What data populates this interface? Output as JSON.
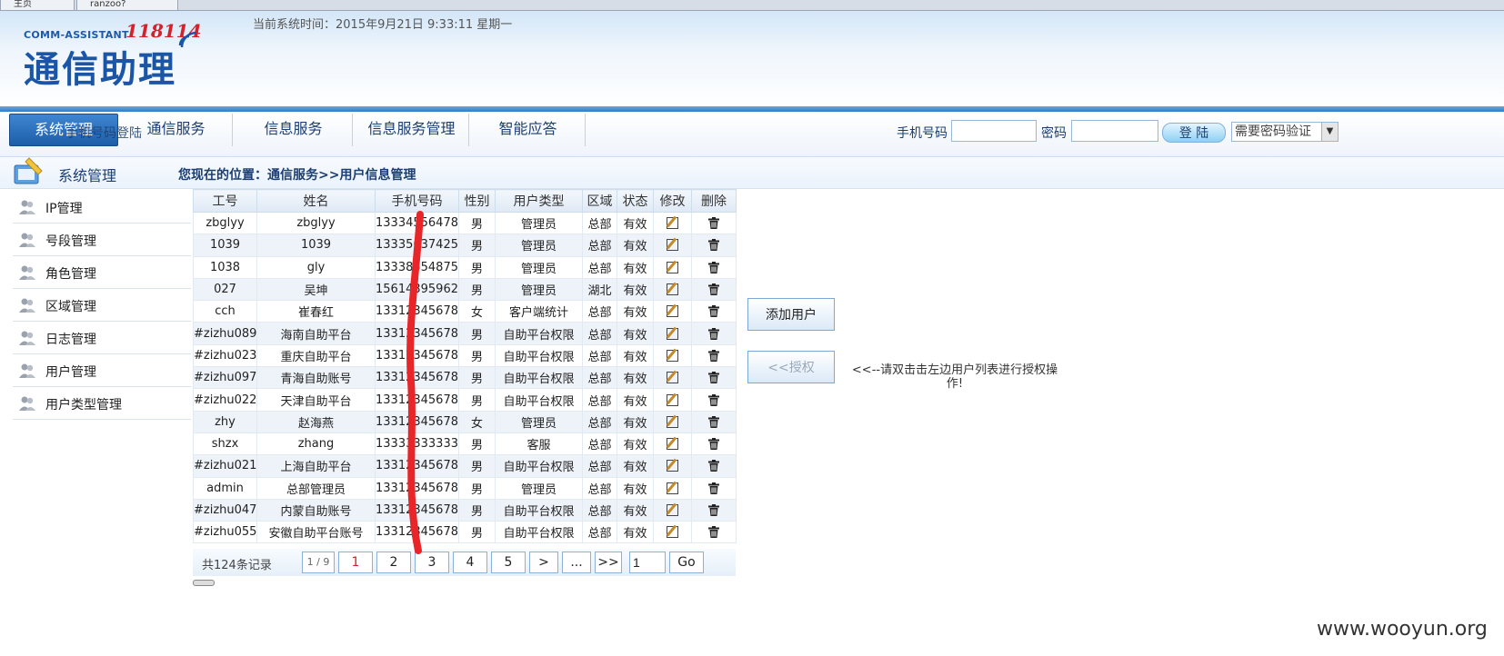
{
  "browser_tabs": [
    "主页",
    "ranzoo?"
  ],
  "header": {
    "logo_small": "COMM-ASSISTANT",
    "logo_number": "118114",
    "logo_big": "通信助理",
    "system_time": "当前系统时间：2015年9月21日 9:33:11 星期一"
  },
  "nav": {
    "tabs": [
      "系统管理",
      "通信服务",
      "信息服务",
      "信息服务管理",
      "智能应答"
    ],
    "ghost_text": "手机号码登陆"
  },
  "login": {
    "phone_label": "手机号码",
    "password_label": "密码",
    "login_button": "登 陆",
    "select_value": "需要密码验证"
  },
  "section": {
    "title": "系统管理",
    "breadcrumb": "您现在的位置：通信服务>>用户信息管理"
  },
  "sidebar": {
    "items": [
      "IP管理",
      "号段管理",
      "角色管理",
      "区域管理",
      "日志管理",
      "用户管理",
      "用户类型管理"
    ]
  },
  "table": {
    "headers": [
      "工号",
      "姓名",
      "手机号码",
      "性别",
      "用户类型",
      "区域",
      "状态",
      "修改",
      "删除"
    ],
    "rows": [
      [
        "zbglyy",
        "zbglyy",
        "13334556478",
        "男",
        "管理员",
        "总部",
        "有效"
      ],
      [
        "1039",
        "1039",
        "13335637425",
        "男",
        "管理员",
        "总部",
        "有效"
      ],
      [
        "1038",
        "gly",
        "13338554875",
        "男",
        "管理员",
        "总部",
        "有效"
      ],
      [
        "027",
        "吴坤",
        "15614395962",
        "男",
        "管理员",
        "湖北",
        "有效"
      ],
      [
        "cch",
        "崔春红",
        "13312345678",
        "女",
        "客户端统计",
        "总部",
        "有效"
      ],
      [
        "#zizhu089",
        "海南自助平台",
        "13312345678",
        "男",
        "自助平台权限",
        "总部",
        "有效"
      ],
      [
        "#zizhu023",
        "重庆自助平台",
        "13312345678",
        "男",
        "自助平台权限",
        "总部",
        "有效"
      ],
      [
        "#zizhu097",
        "青海自助账号",
        "13312345678",
        "男",
        "自助平台权限",
        "总部",
        "有效"
      ],
      [
        "#zizhu022",
        "天津自助平台",
        "13312345678",
        "男",
        "自助平台权限",
        "总部",
        "有效"
      ],
      [
        "zhy",
        "赵海燕",
        "13312345678",
        "女",
        "管理员",
        "总部",
        "有效"
      ],
      [
        "shzx",
        "zhang",
        "13333333333",
        "男",
        "客服",
        "总部",
        "有效"
      ],
      [
        "#zizhu021",
        "上海自助平台",
        "13312345678",
        "男",
        "自助平台权限",
        "总部",
        "有效"
      ],
      [
        "admin",
        "总部管理员",
        "13312345678",
        "男",
        "管理员",
        "总部",
        "有效"
      ],
      [
        "#zizhu047",
        "内蒙自助账号",
        "13312345678",
        "男",
        "自助平台权限",
        "总部",
        "有效"
      ],
      [
        "#zizhu055",
        "安徽自助平台账号",
        "13312345678",
        "男",
        "自助平台权限",
        "总部",
        "有效"
      ]
    ]
  },
  "pager": {
    "total": "共124条记录",
    "page_of": "1 / 9",
    "pages": [
      "1",
      "2",
      "3",
      "4",
      "5"
    ],
    "next": ">",
    "ellipsis": "...",
    "last": ">>",
    "goto_value": "1",
    "go": "Go"
  },
  "actions": {
    "add_user": "添加用户",
    "authorize": "<<授权",
    "hint": "<<--请双击击左边用户列表进行授权操作!"
  },
  "watermark": "www.wooyun.org"
}
